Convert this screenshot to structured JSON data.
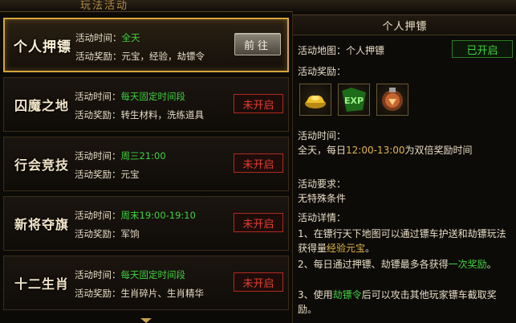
{
  "header_tab": "玩法活动",
  "list": {
    "cards": [
      {
        "title": "个人押镖",
        "time_label": "活动时间：",
        "time_value": "全天",
        "reward_label": "活动奖励：",
        "reward_value": "元宝，经验，劫镖令",
        "button": "前往",
        "status": "open"
      },
      {
        "title": "囚魔之地",
        "time_label": "活动时间：",
        "time_value": "每天固定时间段",
        "reward_label": "活动奖励：",
        "reward_value": "转生材料，洗练道具",
        "button": "未开启",
        "status": "closed"
      },
      {
        "title": "行会竞技",
        "time_label": "活动时间：",
        "time_value": "周三21:00",
        "reward_label": "活动奖励：",
        "reward_value": "元宝",
        "button": "未开启",
        "status": "closed"
      },
      {
        "title": "新将夺旗",
        "time_label": "活动时间：",
        "time_value": "周末19:00-19:10",
        "reward_label": "活动奖励：",
        "reward_value": "军饷",
        "button": "未开启",
        "status": "closed"
      },
      {
        "title": "十二生肖",
        "time_label": "活动时间：",
        "time_value": "每天固定时间段",
        "reward_label": "活动奖励：",
        "reward_value": "生肖碎片、生肖精华",
        "button": "未开启",
        "status": "closed"
      }
    ]
  },
  "detail": {
    "title": "个人押镖",
    "map_label": "活动地图：",
    "map_value": "个人押镖",
    "status": "已开启",
    "reward_label": "活动奖励：",
    "reward_icons": [
      "gold-ingot-icon",
      "exp-icon",
      "rob-token-icon"
    ],
    "time_label": "活动时间：",
    "time_prefix": "全天，每日",
    "time_highlight": "12:00-13:00",
    "time_suffix": "为双倍奖励时间",
    "req_label": "活动要求：",
    "req_value": "无特殊条件",
    "detail_label": "活动详情：",
    "d1_a": "1、在镖行天下地图可以通过镖车护送和劫镖玩法获得量",
    "d1_b": "经验元宝",
    "d1_c": "。",
    "d2_a": "2、每日通过押镖、劫镖最多各获得",
    "d2_b": "一次奖励",
    "d2_c": "。",
    "d3_a": "3、使用",
    "d3_b": "劫镖令",
    "d3_c": "后可以攻击其他玩家镖车截取奖励。"
  },
  "colors": {
    "accent": "#d6a53a",
    "open": "#3fd23f",
    "closed": "#e63b2e"
  }
}
